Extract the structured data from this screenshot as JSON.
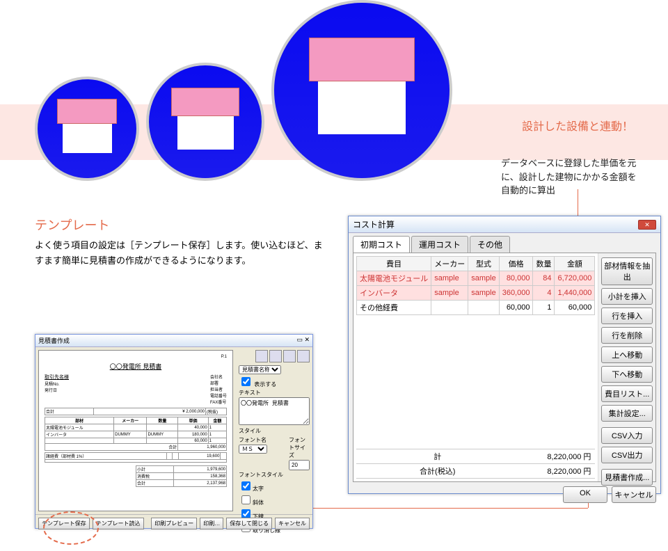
{
  "annotations": {
    "linked": "設計した設備と連動！",
    "db_note": "データベースに登録した単価を元に、設計した建物にかかる金額を自動的に算出"
  },
  "template_section": {
    "heading": "テンプレート",
    "body": "よく使う項目の設定は［テンプレート保存］します。使い込むほど、ますます簡単に見積書の作成ができるようになります。"
  },
  "estimate_dialog": {
    "title": "見積書作成",
    "doc_title": "〇〇発電所 見積書",
    "dest_label": "取引先名様",
    "info_rows": {
      "company": "会社名",
      "dept": "部署",
      "person": "担当者",
      "tel": "電話番号",
      "fax": "FAX番号"
    },
    "columns": [
      "部材",
      "メーカー",
      "数量",
      "単価",
      "金額"
    ],
    "rows": [
      {
        "c1": "太陽電池モジュール",
        "c2": "",
        "c3": "",
        "c4": "40,000",
        "c5": "1"
      },
      {
        "c1": "インバータ",
        "c2": "DUMMY",
        "c3": "DUMMY",
        "c4": "180,000",
        "c5": "1"
      },
      {
        "c1": "",
        "c2": "",
        "c3": "",
        "c4": "60,000",
        "c5": "1"
      }
    ],
    "section_total_label": "合計",
    "section_total": "1,960,000",
    "fee_label": "諸経費（部材費 1%）",
    "fee_value": "19,600",
    "grand_items": [
      {
        "l": "小計",
        "v": "1,979,600"
      },
      {
        "l": "消費税",
        "v": "158,368"
      },
      {
        "l": "合計",
        "v": "2,137,968"
      }
    ],
    "side": {
      "part_label": "見積書名称",
      "show_label": "表示する",
      "text_label": "テキスト",
      "text_value": "〇〇発電所 見積書",
      "style_label": "スタイル",
      "font_label": "フォント名",
      "font_value": "ＭＳ Ｐゴシック",
      "size_label": "フォントサイズ",
      "size_value": "20",
      "fontstyle_label": "フォントスタイル",
      "bold": "太字",
      "italic": "斜体",
      "uline": "下線",
      "strike": "取り消し線"
    },
    "buttons": {
      "tmpl_save": "テンプレート保存",
      "tmpl_load": "テンプレート読込",
      "preview": "印刷プレビュー",
      "print": "印刷…",
      "save_close": "保存して閉じる",
      "cancel": "キャンセル"
    }
  },
  "cost_dialog": {
    "title": "コスト計算",
    "tabs": [
      "初期コスト",
      "運用コスト",
      "その他"
    ],
    "columns": [
      "費目",
      "メーカー",
      "型式",
      "価格",
      "数量",
      "金額"
    ],
    "rows": [
      {
        "item": "太陽電池モジュール",
        "maker": "sample",
        "model": "sample",
        "price": "80,000",
        "qty": "84",
        "amount": "6,720,000",
        "hl": true
      },
      {
        "item": "インバータ",
        "maker": "sample",
        "model": "sample",
        "price": "360,000",
        "qty": "4",
        "amount": "1,440,000",
        "hl": true
      },
      {
        "item": "その他経費",
        "maker": "",
        "model": "",
        "price": "60,000",
        "qty": "1",
        "amount": "60,000",
        "hl": false
      }
    ],
    "totals": {
      "sum_label": "計",
      "sum": "8,220,000",
      "sum_unit": "円",
      "tax_label": "合計(税込)",
      "tax": "8,220,000",
      "tax_unit": "円"
    },
    "side_buttons": {
      "extract": "部材情報を抽出",
      "insert_sub": "小計を挿入",
      "insert_row": "行を挿入",
      "delete_row": "行を削除",
      "move_up": "上へ移動",
      "move_down": "下へ移動",
      "item_list": "費目リスト...",
      "agg": "集計設定...",
      "csv_in": "CSV入力",
      "csv_out": "CSV出力",
      "make_est": "見積書作成..."
    },
    "dialog_buttons": {
      "ok": "OK",
      "cancel": "キャンセル"
    }
  }
}
